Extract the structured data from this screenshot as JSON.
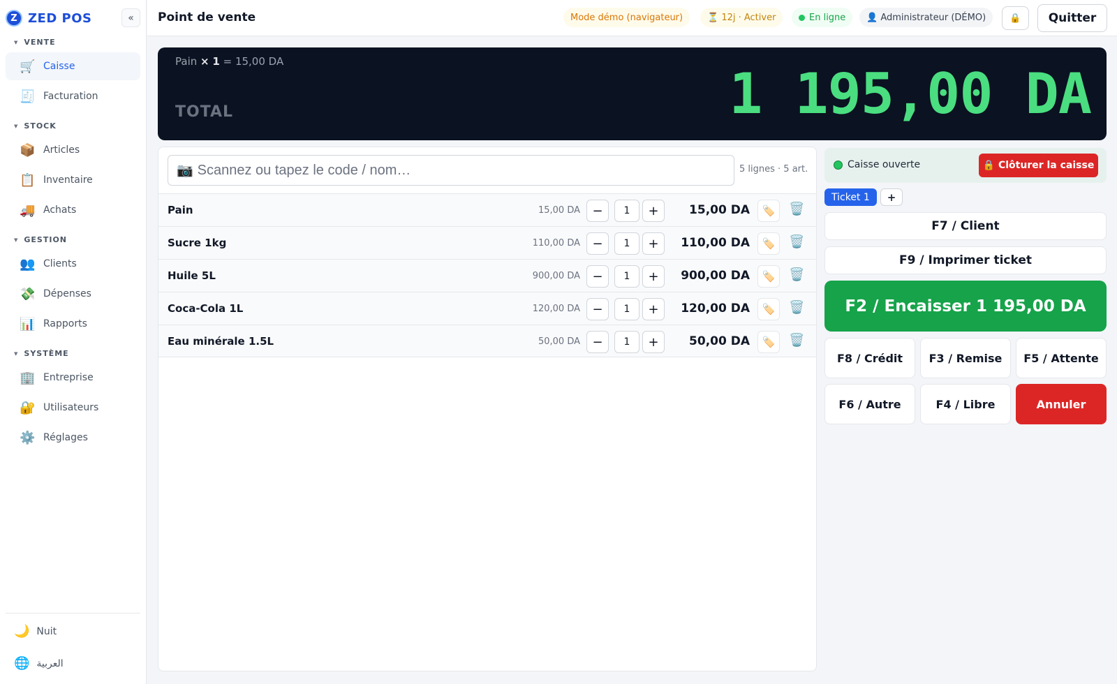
{
  "brand": {
    "logo_letter": "Z",
    "name": "ZED POS",
    "collapse_icon": "«"
  },
  "sidebar": {
    "sections": [
      {
        "title": "VENTE"
      },
      {
        "title": "STOCK"
      },
      {
        "title": "GESTION"
      },
      {
        "title": "SYSTÈME"
      }
    ],
    "items": [
      {
        "label": "Caisse",
        "icon": "🛒",
        "active": true
      },
      {
        "label": "Facturation",
        "icon": "🧾"
      },
      {
        "label": "Articles",
        "icon": "📦"
      },
      {
        "label": "Inventaire",
        "icon": "📋"
      },
      {
        "label": "Achats",
        "icon": "🚚"
      },
      {
        "label": "Clients",
        "icon": "👥"
      },
      {
        "label": "Dépenses",
        "icon": "💸"
      },
      {
        "label": "Rapports",
        "icon": "📊"
      },
      {
        "label": "Entreprise",
        "icon": "🏢"
      },
      {
        "label": "Utilisateurs",
        "icon": "🔐"
      },
      {
        "label": "Réglages",
        "icon": "⚙️"
      }
    ],
    "footer": [
      {
        "label": "Nuit",
        "icon": "🌙"
      },
      {
        "label": "العربية",
        "icon": "🌐"
      }
    ]
  },
  "header": {
    "title": "Point de vente",
    "demo_mode": "Mode démo (navigateur)",
    "trial": "⏳ 12j · Activer",
    "status": "En ligne",
    "user": "👤 Administrateur (DÉMO)",
    "lock_icon": "🔒",
    "quit_label": "Quitter"
  },
  "total": {
    "last_line_item": "Pain",
    "last_line_times": "×",
    "last_line_qty": "1",
    "last_line_result": "= 15,00 DA",
    "label": "TOTAL",
    "value": "1 195,00 DA"
  },
  "cart": {
    "scan_icon": "📷",
    "scan_placeholder": "Scannez ou tapez le code / nom…",
    "count": "5 lignes · 5 art.",
    "minus": "−",
    "plus": "+",
    "tag_icon": "🏷️",
    "delete_icon": "🗑️",
    "rows": [
      {
        "name": "Pain",
        "unit_price": "15,00 DA",
        "qty": "1",
        "total": "15,00 DA"
      },
      {
        "name": "Sucre 1kg",
        "unit_price": "110,00 DA",
        "qty": "1",
        "total": "110,00 DA"
      },
      {
        "name": "Huile 5L",
        "unit_price": "900,00 DA",
        "qty": "1",
        "total": "900,00 DA"
      },
      {
        "name": "Coca-Cola 1L",
        "unit_price": "120,00 DA",
        "qty": "1",
        "total": "120,00 DA"
      },
      {
        "name": "Eau minérale 1.5L",
        "unit_price": "50,00 DA",
        "qty": "1",
        "total": "50,00 DA"
      }
    ]
  },
  "register": {
    "status": "Caisse ouverte",
    "close_label": "🔒 Clôturer la caisse"
  },
  "tickets": {
    "active": "Ticket 1",
    "add": "+"
  },
  "actions": {
    "client": "F7 / Client",
    "print": "F9 / Imprimer ticket",
    "pay": "F2 / Encaisser 1 195,00 DA",
    "credit": "F8 / Crédit",
    "discount": "F3 / Remise",
    "hold": "F5 / Attente",
    "other": "F6 / Autre",
    "free": "F4 / Libre",
    "cancel": "Annuler"
  },
  "colors": {
    "accent": "#2563eb",
    "total_text": "#4ade80",
    "pay": "#16a34a",
    "danger": "#dc2626"
  }
}
